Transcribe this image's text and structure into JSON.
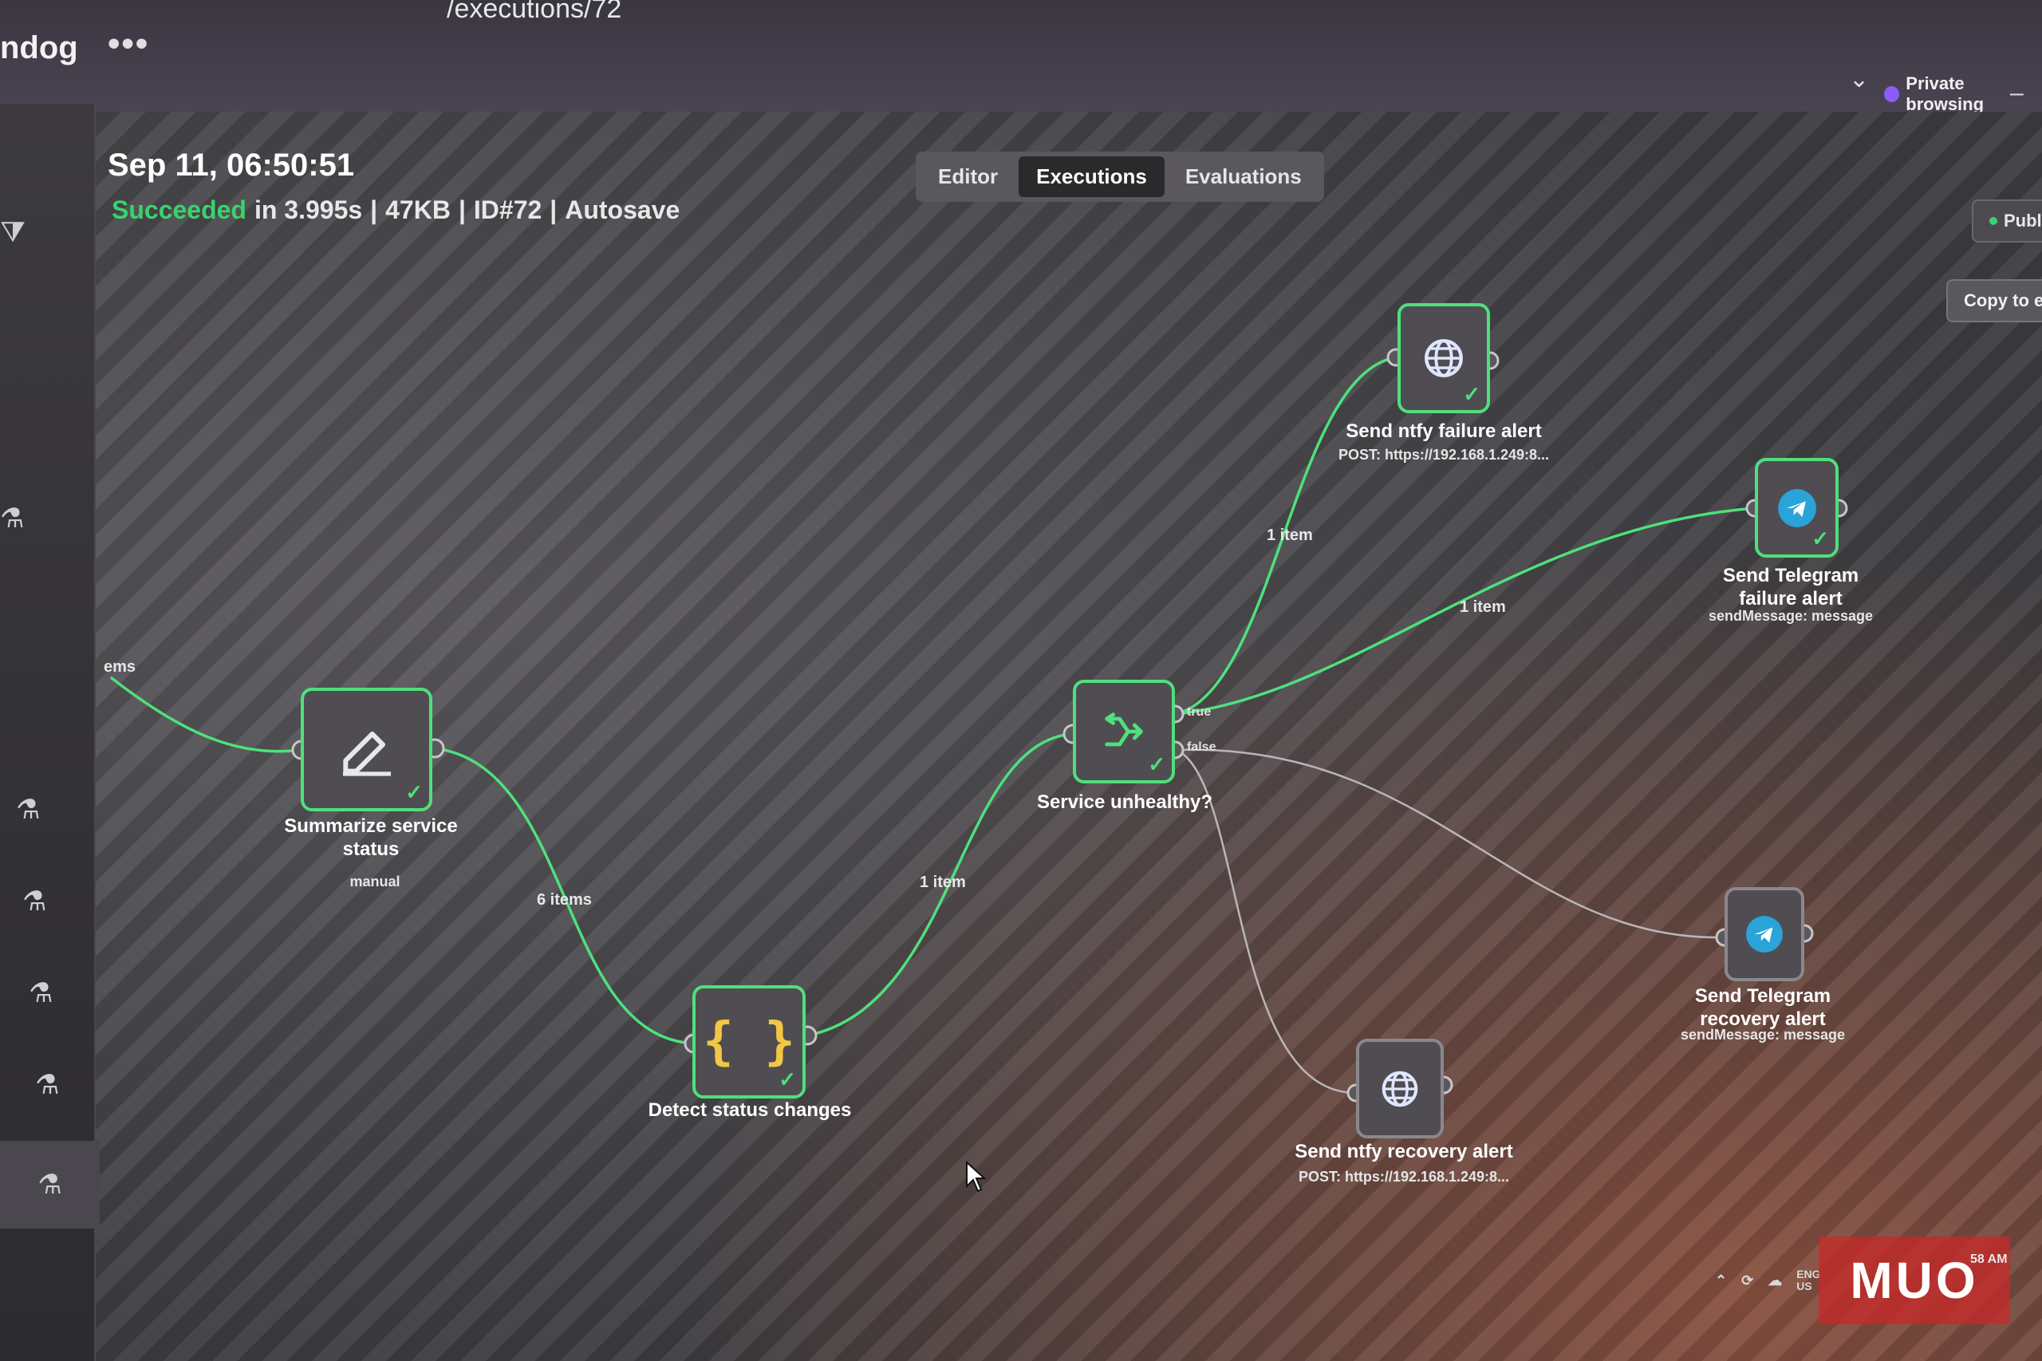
{
  "browser": {
    "app_name": "ndog",
    "more_label": "•••",
    "url_fragment": "/executions/72",
    "private_label": "Private browsing"
  },
  "execution": {
    "date": "Sep 11, 06:50:51",
    "status": "Succeeded",
    "duration": "in 3.995s",
    "size": "47KB",
    "id": "ID#72",
    "save_mode": "Autosave",
    "separator": "|"
  },
  "tabs": [
    {
      "label": "Editor",
      "active": false
    },
    {
      "label": "Executions",
      "active": true
    },
    {
      "label": "Evaluations",
      "active": false
    }
  ],
  "actions": {
    "publish_label": "Publish",
    "copy_label": "Copy to editor"
  },
  "nodes": {
    "summarize": {
      "label": "Summarize service status",
      "sub": "manual",
      "icon": "edit-icon"
    },
    "detect": {
      "label": "Detect status changes",
      "sub": "",
      "icon": "code-icon"
    },
    "service_check": {
      "label": "Service unhealthy?",
      "sub": "",
      "icon": "if-branch-icon",
      "true_label": "true",
      "false_label": "false"
    },
    "ntfy_failure": {
      "label": "Send ntfy failure alert",
      "sub": "POST: https://192.168.1.249:8...",
      "icon": "globe-icon"
    },
    "telegram_failure": {
      "label": "Send Telegram failure alert",
      "sub": "sendMessage: message",
      "icon": "telegram-icon"
    },
    "telegram_recovery": {
      "label": "Send Telegram recovery alert",
      "sub": "sendMessage: message",
      "icon": "telegram-icon"
    },
    "ntfy_recovery": {
      "label": "Send ntfy recovery alert",
      "sub": "POST: https://192.168.1.249:8...",
      "icon": "globe-icon"
    }
  },
  "edges": {
    "incoming": "ems",
    "summarize_to_detect": "6 items",
    "detect_to_service": "1 item",
    "true_to_ntfy": "1 item",
    "true_to_telegram": "1 item"
  },
  "tray": {
    "lang": "ENG",
    "region": "US",
    "clock": "58 AM"
  },
  "watermark": "MUO",
  "colors": {
    "success": "#39d36c",
    "node_border_active": "#4fe07c",
    "node_border_inactive": "#8a888d",
    "telegram": "#2aa3d9",
    "code_icon": "#f2c744"
  }
}
